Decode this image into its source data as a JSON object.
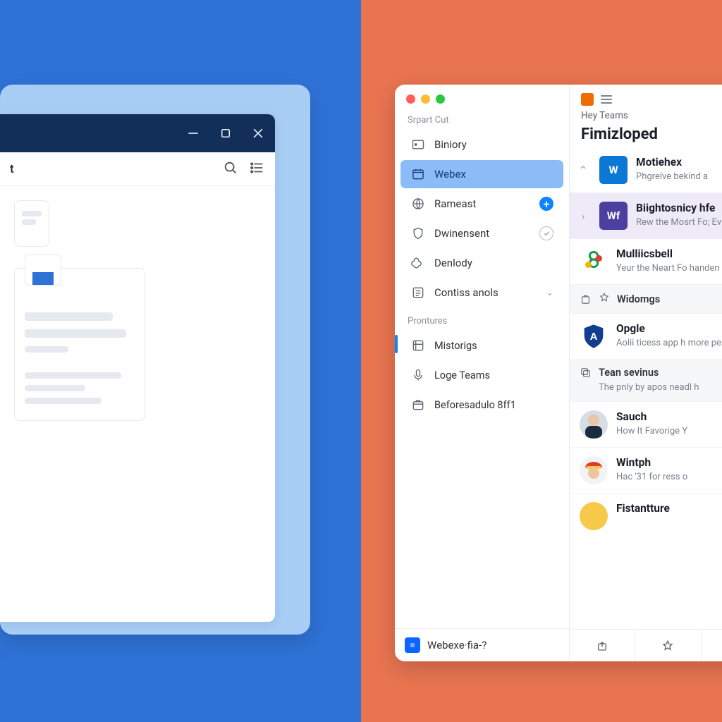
{
  "left_window": {
    "title": "t"
  },
  "sidebar": {
    "section1_label": "Srpart Cut",
    "items1": [
      {
        "label": "Biniory"
      },
      {
        "label": "Webex"
      },
      {
        "label": "Rameast"
      },
      {
        "label": "Dwinensent"
      },
      {
        "label": "Denlody"
      },
      {
        "label": "Contiss anols"
      }
    ],
    "section2_label": "Prontures",
    "items2": [
      {
        "label": "Mistorigs"
      },
      {
        "label": "Loge Teams"
      },
      {
        "label": "Beforesadulo 8ff1"
      }
    ],
    "footer_label": "Webexe·fia-?"
  },
  "main": {
    "subtitle": "Hey Teams",
    "title": "Fimizloped",
    "feed": [
      {
        "kind": "item",
        "title": "Motiehex",
        "sub": "Phgrelve bekind a"
      },
      {
        "kind": "item",
        "title": "Biightosnicy hfe",
        "sub": "Rew the Mosrt Fo; Evileds to the ag"
      },
      {
        "kind": "item",
        "title": "Mulliicsbell",
        "sub": "Yeur the Neart Fo handen ised cron"
      },
      {
        "kind": "section",
        "title": "Widomgs"
      },
      {
        "kind": "item",
        "title": "Opgle",
        "sub": "Aolii ticess app h more per, diderde"
      },
      {
        "kind": "section2",
        "title": "Tean sevinus",
        "sub": "The pnly by apos neadl h"
      },
      {
        "kind": "person",
        "title": "Sauch",
        "sub": "How It Favorige Y"
      },
      {
        "kind": "person",
        "title": "Wintph",
        "sub": "Hac '31 for ress o"
      },
      {
        "kind": "person",
        "title": "Fistantture",
        "sub": ""
      }
    ]
  }
}
